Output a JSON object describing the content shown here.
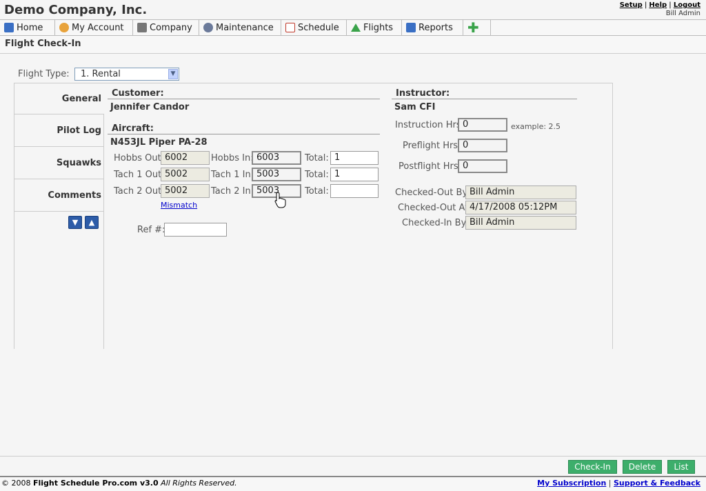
{
  "header": {
    "company": "Demo Company, Inc.",
    "links": [
      "Setup",
      "Help",
      "Logout"
    ],
    "user": "Bill Admin"
  },
  "nav": {
    "items": [
      {
        "label": "Home",
        "icon": "home-icon",
        "color": "#3a6fc4"
      },
      {
        "label": "My Account",
        "icon": "user-icon",
        "color": "#e8a33c"
      },
      {
        "label": "Company",
        "icon": "company-icon",
        "color": "#777777"
      },
      {
        "label": "Maintenance",
        "icon": "gear-icon",
        "color": "#6b7a9a"
      },
      {
        "label": "Schedule",
        "icon": "calendar-icon",
        "color": "#c0392b"
      },
      {
        "label": "Flights",
        "icon": "up-arrow-icon",
        "color": "#3aa34a"
      },
      {
        "label": "Reports",
        "icon": "chart-icon",
        "color": "#3a6fc4"
      },
      {
        "label": "",
        "icon": "plus-icon",
        "color": "#3aa34a"
      }
    ]
  },
  "page": {
    "title": "Flight Check-In",
    "flight_type_label": "Flight Type:",
    "flight_type_value": "1. Rental"
  },
  "tabs": [
    "General",
    "Pilot Log",
    "Squawks",
    "Comments"
  ],
  "customer": {
    "heading": "Customer:",
    "name": "Jennifer Candor"
  },
  "aircraft": {
    "heading": "Aircraft:",
    "name": "N453JL Piper PA-28",
    "rows": [
      {
        "out_label": "Hobbs Out:",
        "out": "6002",
        "in_label": "Hobbs In:",
        "in": "6003",
        "total_label": "Total:",
        "total": "1"
      },
      {
        "out_label": "Tach 1 Out:",
        "out": "5002",
        "in_label": "Tach 1 In:",
        "in": "5003",
        "total_label": "Total:",
        "total": "1"
      },
      {
        "out_label": "Tach 2 Out:",
        "out": "5002",
        "in_label": "Tach 2 In:",
        "in": "5003",
        "total_label": "Total:",
        "total": ""
      }
    ],
    "mismatch": "Mismatch",
    "ref_label": "Ref #:",
    "ref_value": ""
  },
  "instructor": {
    "heading": "Instructor:",
    "name": "Sam CFI",
    "instruction_label": "Instruction Hrs:",
    "instruction": "0",
    "example": "example: 2.5",
    "preflight_label": "Preflight Hrs:",
    "preflight": "0",
    "postflight_label": "Postflight Hrs:",
    "postflight": "0",
    "checked_out_by_label": "Checked-Out By:",
    "checked_out_by": "Bill Admin",
    "checked_out_at_label": "Checked-Out At:",
    "checked_out_at": "4/17/2008 05:12PM",
    "checked_in_by_label": "Checked-In By:",
    "checked_in_by": "Bill Admin"
  },
  "actions": {
    "checkin": "Check-In",
    "delete": "Delete",
    "list": "List"
  },
  "footer": {
    "copyright_prefix": "© 2008",
    "brand": "Flight Schedule Pro.com v3.0",
    "rights": "All Rights Reserved.",
    "subscription": "My Subscription",
    "support": "Support & Feedback"
  },
  "colors": {
    "action_button": "#3dae6b",
    "arrow_button": "#2d5ca8",
    "link": "#0000cc"
  }
}
